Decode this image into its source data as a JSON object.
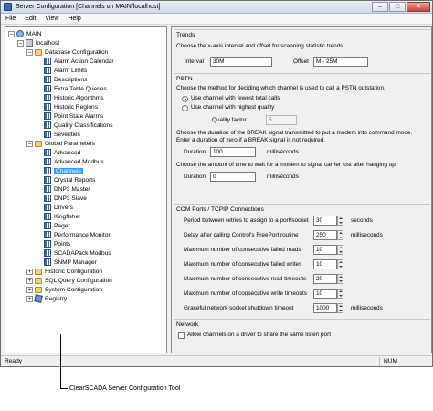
{
  "window": {
    "title": "Server Configuration [Channels on MAIN/localhost]"
  },
  "menu": [
    "File",
    "Edit",
    "View",
    "Help"
  ],
  "tree": {
    "root": "MAIN",
    "host": "localhost",
    "db_config": "Database Configuration",
    "db_items": [
      "Alarm Action Calendar",
      "Alarm Limits",
      "Descriptions",
      "Extra Table Queries",
      "Historic Algorithms",
      "Historic Regions",
      "Point State Alarms",
      "Quality Classifications",
      "Severities"
    ],
    "global": "Global Parameters",
    "global_items": [
      "Advanced",
      "Advanced Modbus",
      "Channels",
      "Crystal Reports",
      "DNP3 Master",
      "DNP3 Slave",
      "Drivers",
      "Kingfisher",
      "Pager",
      "Performance Monitor",
      "Points",
      "SCADAPack Modbus",
      "SNMP Manager"
    ],
    "other": [
      "Historic Configuration",
      "SQL Query Configuration",
      "System Configuration",
      "Registry"
    ]
  },
  "trends": {
    "title": "Trends",
    "desc": "Choose the x-axis interval and offset for scanning statistic trends.",
    "interval_label": "Interval",
    "interval": "30M",
    "offset_label": "Offset",
    "offset": "M - 25M"
  },
  "pstn": {
    "title": "PSTN",
    "desc": "Choose the method for deciding which channel is used to call a PSTN outstation.",
    "opt1": "Use channel with fewest total calls",
    "opt2": "Use channel with highest quality",
    "qf_label": "Quality factor",
    "qf": "5",
    "desc2a": "Choose the duration of the BREAK signal transmitted to put a modem into command mode.",
    "desc2b": "Enter a duration of zero if a BREAK signal is not required.",
    "dur_label": "Duration",
    "dur1": "100",
    "dur1_unit": "milliseconds",
    "desc3": "Choose the amount of time to wait for a modem to signal carrier lost after hanging up.",
    "dur2": "0",
    "dur2_unit": "milliseconds"
  },
  "com": {
    "title": "COM Ports / TCPIP Connections",
    "rows": [
      {
        "label": "Period between retries to assign to a port/socket",
        "value": "30",
        "unit": "seconds"
      },
      {
        "label": "Delay after calling Control's FreePort routine",
        "value": "250",
        "unit": "milliseconds"
      },
      {
        "label": "Maximum number of consecutive failed reads",
        "value": "10",
        "unit": ""
      },
      {
        "label": "Maximum number of consecutive failed writes",
        "value": "10",
        "unit": ""
      },
      {
        "label": "Maximum number of consecutive read timeouts",
        "value": "20",
        "unit": ""
      },
      {
        "label": "Maximum number of consecutive write timeouts",
        "value": "10",
        "unit": ""
      },
      {
        "label": "Graceful network socket shutdown timeout",
        "value": "1000",
        "unit": "milliseconds"
      }
    ]
  },
  "network": {
    "title": "Network",
    "opt": "Allow channels on a driver to share the same listen port"
  },
  "status": {
    "left": "Ready",
    "right": "NUM"
  },
  "caption": "ClearSCADA Server Configuration Tool"
}
